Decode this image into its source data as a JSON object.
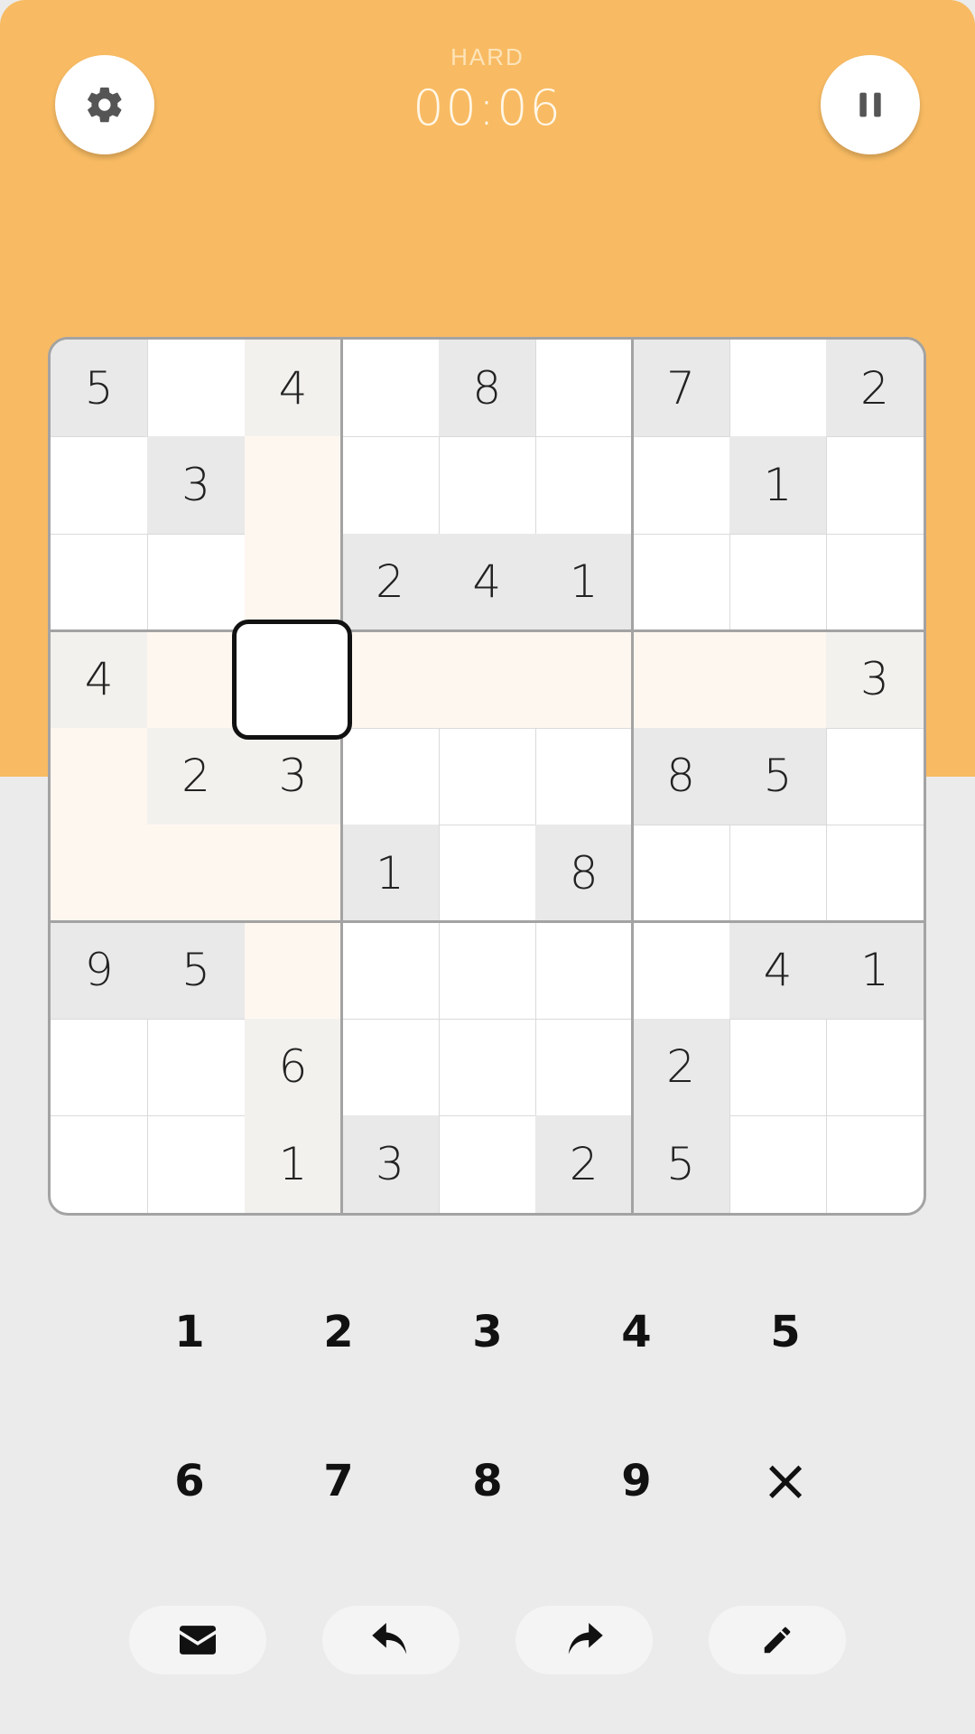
{
  "header": {
    "difficulty": "HARD",
    "timer": "00:06",
    "settings_icon": "gear-icon",
    "pause_icon": "pause-icon"
  },
  "colors": {
    "accent": "#f8bb63",
    "background": "#ebebeb",
    "given_cell": "#e9e9e9",
    "highlight_cell": "#fef7f0"
  },
  "board": {
    "selected": {
      "row": 3,
      "col": 2
    },
    "rows": [
      [
        "5",
        "",
        "4",
        "",
        "8",
        "",
        "7",
        "",
        "2"
      ],
      [
        "",
        "3",
        "",
        "",
        "",
        "",
        "",
        "1",
        ""
      ],
      [
        "",
        "",
        "",
        "2",
        "4",
        "1",
        "",
        "",
        ""
      ],
      [
        "4",
        "",
        "",
        "",
        "",
        "",
        "",
        "",
        "3"
      ],
      [
        "",
        "2",
        "3",
        "",
        "",
        "",
        "8",
        "5",
        ""
      ],
      [
        "",
        "",
        "",
        "1",
        "",
        "8",
        "",
        "",
        ""
      ],
      [
        "9",
        "5",
        "",
        "",
        "",
        "",
        "",
        "4",
        "1"
      ],
      [
        "",
        "",
        "6",
        "",
        "",
        "",
        "2",
        "",
        ""
      ],
      [
        "",
        "",
        "1",
        "3",
        "",
        "2",
        "5",
        "",
        ""
      ]
    ]
  },
  "numpad": {
    "keys": [
      "1",
      "2",
      "3",
      "4",
      "5",
      "6",
      "7",
      "8",
      "9",
      "×"
    ]
  },
  "toolbar": {
    "mail_icon": "envelope-icon",
    "undo_icon": "undo-icon",
    "redo_icon": "redo-icon",
    "notes_icon": "pencil-icon"
  }
}
